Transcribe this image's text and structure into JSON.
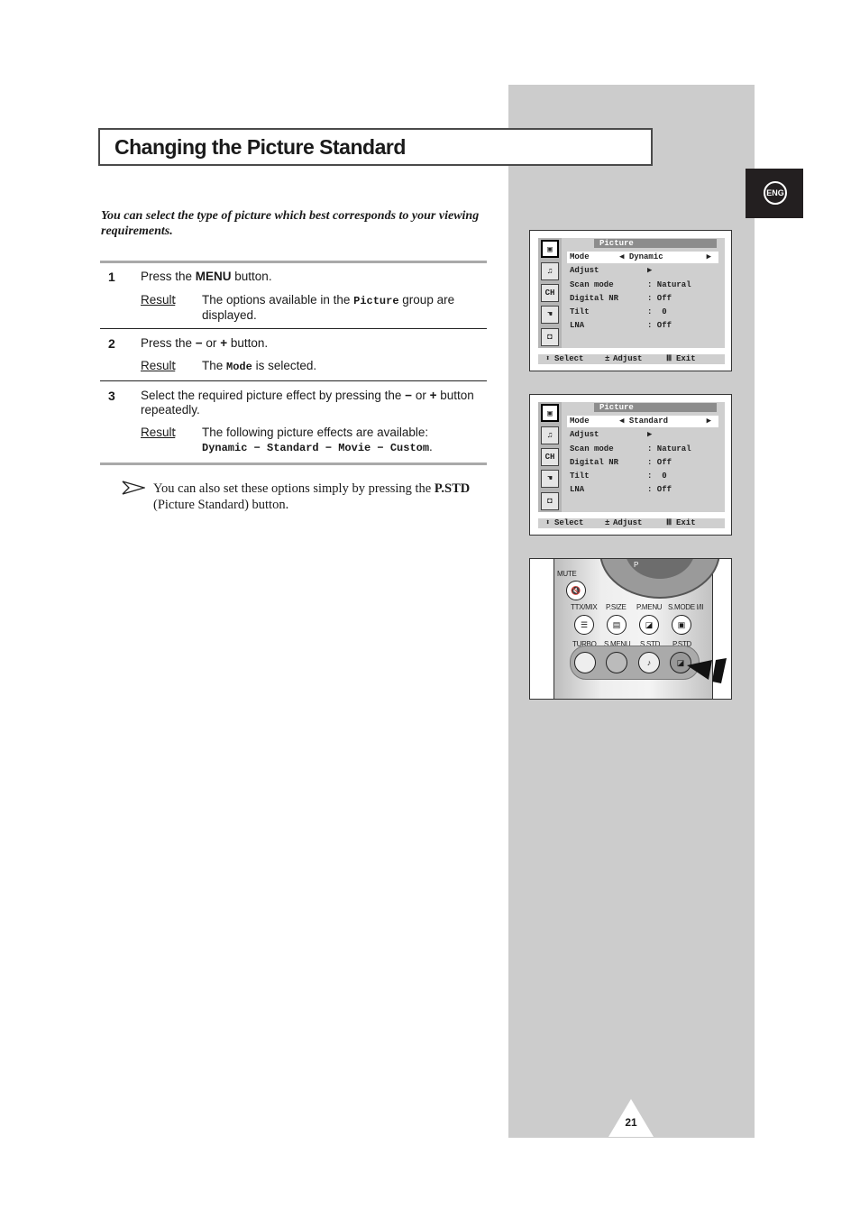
{
  "page": {
    "title": "Changing the Picture Standard",
    "language_badge": "ENG",
    "page_number": "21"
  },
  "intro": "You can select the type of picture which best corresponds to your viewing requirements.",
  "steps": [
    {
      "number": "1",
      "instruction_pre": "Press the ",
      "instruction_key": "MENU",
      "instruction_post": " button.",
      "result_label": "Result",
      "result_pre": "The options available in the ",
      "result_code": "Picture",
      "result_post": " group are displayed."
    },
    {
      "number": "2",
      "instruction_pre": "Press the ",
      "instruction_key": "−",
      "instruction_mid": " or ",
      "instruction_key2": "+",
      "instruction_post": " button.",
      "result_label": "Result",
      "result_pre": "The ",
      "result_code": "Mode",
      "result_post": " is selected."
    },
    {
      "number": "3",
      "instruction_pre": "Select the required picture effect by pressing the ",
      "instruction_key": "−",
      "instruction_mid": " or ",
      "instruction_key2": "+",
      "instruction_post": " button repeatedly.",
      "result_label": "Result",
      "result_pre": "The following picture effects are available:",
      "result_code": "Dynamic − Standard − Movie − Custom",
      "result_post": "."
    }
  ],
  "note": {
    "icon": "arrow-pointer-icon",
    "pre": "You can also set these options simply by pressing the ",
    "key": "P.STD",
    "post": " (Picture Standard) button."
  },
  "osd_screens": [
    {
      "title": "Picture",
      "rows": [
        {
          "label": "Mode",
          "value": "Dynamic",
          "type": "selector"
        },
        {
          "label": "Adjust",
          "value": "",
          "type": "submenu"
        },
        {
          "label": "Scan mode",
          "value": ": Natural",
          "type": "value"
        },
        {
          "label": "Digital NR",
          "value": ": Off",
          "type": "value"
        },
        {
          "label": "Tilt",
          "value": ":  0",
          "type": "value"
        },
        {
          "label": "LNA",
          "value": ": Off",
          "type": "value"
        }
      ],
      "footer": {
        "select": "Select",
        "adjust": "Adjust",
        "exit": "Exit"
      }
    },
    {
      "title": "Picture",
      "rows": [
        {
          "label": "Mode",
          "value": "Standard",
          "type": "selector"
        },
        {
          "label": "Adjust",
          "value": "",
          "type": "submenu"
        },
        {
          "label": "Scan mode",
          "value": ": Natural",
          "type": "value"
        },
        {
          "label": "Digital NR",
          "value": ": Off",
          "type": "value"
        },
        {
          "label": "Tilt",
          "value": ":  0",
          "type": "value"
        },
        {
          "label": "LNA",
          "value": ": Off",
          "type": "value"
        }
      ],
      "footer": {
        "select": "Select",
        "adjust": "Adjust",
        "exit": "Exit"
      }
    }
  ],
  "osd_icons": [
    "tv-picture-icon",
    "sound-icon",
    "channel-icon",
    "setup-hand-icon",
    "input-tv-icon"
  ],
  "remote": {
    "top_label": "P",
    "labels_row1": [
      "MUTE"
    ],
    "labels_row2": [
      "TTX/MIX",
      "P.SIZE",
      "P.MENU",
      "S.MODE I/II"
    ],
    "labels_row3": [
      "TURBO",
      "S.MENU",
      "S.STD",
      "P.STD"
    ]
  },
  "colors": {
    "sidebar": "#cccccc",
    "badge": "#231f20",
    "osd_title_bar": "#8c8c8c"
  }
}
